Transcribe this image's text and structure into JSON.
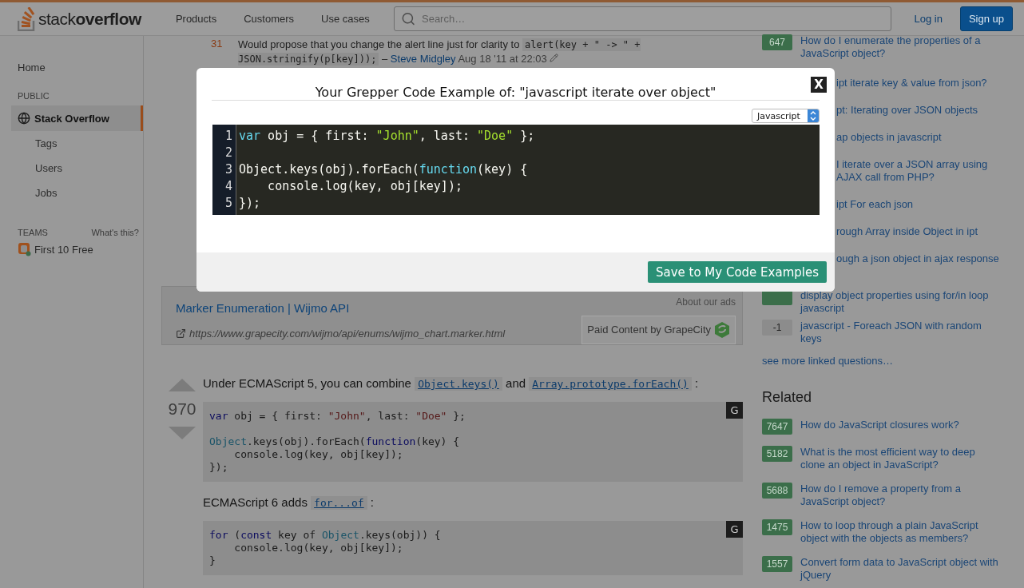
{
  "header": {
    "logo": "stack**overflow**",
    "nav": [
      "Products",
      "Customers",
      "Use cases"
    ],
    "search": {
      "placeholder": "Search…"
    },
    "login": "Log in",
    "signup": "Sign up"
  },
  "sidebar": {
    "home": "Home",
    "public_title": "PUBLIC",
    "items": [
      {
        "label": "Stack Overflow",
        "kind": "site",
        "selected": true
      },
      {
        "label": "Tags",
        "kind": "sub",
        "selected": false
      },
      {
        "label": "Users",
        "kind": "sub",
        "selected": false
      },
      {
        "label": "Jobs",
        "kind": "sub",
        "selected": false
      }
    ],
    "teams_title": "TEAMS",
    "teams_help": "What's this?",
    "teams_item": "First 10 Free"
  },
  "comment": {
    "score": "31",
    "segments": [
      {
        "kind": "text",
        "text": "Would propose that you change the alert line just for clarity to "
      },
      {
        "kind": "code",
        "text": "alert(key + \" -> \" + JSON.stringify(p[key]));"
      },
      {
        "kind": "text",
        "text": " – "
      },
      {
        "kind": "user",
        "text": "Steve Midgley"
      },
      {
        "kind": "date",
        "text": " Aug 18 '11 at 22:03"
      }
    ]
  },
  "ad": {
    "title": "Marker Enumeration | Wijmo API",
    "url": "https://www.grapecity.com/wijmo/api/enums/wijmo_chart.marker.html",
    "about": "About our ads",
    "sponsor": "Paid Content by GrapeCity"
  },
  "answer": {
    "votes": "970",
    "blocks": [
      {
        "kind": "paragraph",
        "segments": [
          {
            "kind": "text",
            "text": "Under ECMAScript 5, you can combine "
          },
          {
            "kind": "code",
            "text": "Object.keys()"
          },
          {
            "kind": "text",
            "text": " and "
          },
          {
            "kind": "code",
            "text": "Array.prototype.forEach()"
          },
          {
            "kind": "text",
            "text": " :"
          }
        ]
      },
      {
        "kind": "code",
        "button": "G",
        "lines": [
          {
            "tokens": [
              {
                "kind": "keyword",
                "text": "var"
              },
              {
                "kind": "plain",
                "text": " obj = { first: "
              },
              {
                "kind": "string",
                "text": "\"John\""
              },
              {
                "kind": "plain",
                "text": ", last: "
              },
              {
                "kind": "string",
                "text": "\"Doe\""
              },
              {
                "kind": "plain",
                "text": " };"
              }
            ]
          },
          {
            "kind": "blank"
          },
          {
            "tokens": [
              {
                "kind": "type",
                "text": "Object"
              },
              {
                "kind": "plain",
                "text": ".keys(obj).forEach("
              },
              {
                "kind": "keyword",
                "text": "function"
              },
              {
                "kind": "plain",
                "text": "(key) {"
              }
            ]
          },
          {
            "tokens": [
              {
                "kind": "plain",
                "text": "    console.log(key, obj[key]);"
              }
            ]
          },
          {
            "tokens": [
              {
                "kind": "plain",
                "text": "});"
              }
            ]
          }
        ]
      },
      {
        "kind": "paragraph",
        "segments": [
          {
            "kind": "text",
            "text": "ECMAScript 6 adds "
          },
          {
            "kind": "code",
            "text": "for...of"
          },
          {
            "kind": "text",
            "text": " :"
          }
        ]
      },
      {
        "kind": "code",
        "button": "G",
        "lines": [
          {
            "tokens": [
              {
                "kind": "keyword",
                "text": "for"
              },
              {
                "kind": "plain",
                "text": " ("
              },
              {
                "kind": "keyword",
                "text": "const"
              },
              {
                "kind": "plain",
                "text": " key of "
              },
              {
                "kind": "type",
                "text": "Object"
              },
              {
                "kind": "plain",
                "text": ".keys(obj)) {"
              }
            ]
          },
          {
            "tokens": [
              {
                "kind": "plain",
                "text": "    console.log(key, obj[key]);"
              }
            ]
          },
          {
            "tokens": [
              {
                "kind": "plain",
                "text": "}"
              }
            ]
          }
        ]
      }
    ]
  },
  "linked": {
    "items": [
      {
        "kind": "full",
        "score": "647",
        "title": "How do I enumerate the properties of a JavaScript object?"
      },
      {
        "kind": "partial",
        "title": "ipt iterate key & value from json?"
      },
      {
        "kind": "partial",
        "title": "pt: Iterating over JSON objects"
      },
      {
        "kind": "partial",
        "title": "ap objects in javascript"
      },
      {
        "kind": "partial",
        "title": "I iterate over a JSON array using AJAX call from PHP?"
      },
      {
        "kind": "partial",
        "title": "ipt For each json"
      },
      {
        "kind": "partial",
        "title": "rough Array inside Object in ipt"
      },
      {
        "kind": "partial",
        "title": "ough a json object in ajax response"
      },
      {
        "kind": "covered",
        "title": "display object properties using for/in loop javascript"
      },
      {
        "kind": "neutral",
        "score": "-1",
        "title": "javascript - Foreach JSON with random keys"
      }
    ],
    "more": "see more linked questions…"
  },
  "related": {
    "title": "Related",
    "items": [
      {
        "score": "7647",
        "title": "How do JavaScript closures work?"
      },
      {
        "score": "5182",
        "title": "What is the most efficient way to deep clone an object in JavaScript?"
      },
      {
        "score": "5688",
        "title": "How do I remove a property from a JavaScript object?"
      },
      {
        "score": "1475",
        "title": "How to loop through a plain JavaScript object with the objects as members?"
      },
      {
        "score": "1557",
        "title": "Convert form data to JavaScript object with jQuery"
      }
    ]
  },
  "modal": {
    "title": "Your Grepper Code Example of: \"javascript iterate over object\"",
    "close": "X",
    "language": "Javascript",
    "lines": [
      {
        "number": "1",
        "tokens": [
          {
            "kind": "keyword",
            "text": "var"
          },
          {
            "kind": "plain",
            "text": " obj = { first: "
          },
          {
            "kind": "string",
            "text": "\"John\""
          },
          {
            "kind": "plain",
            "text": ", last: "
          },
          {
            "kind": "string",
            "text": "\"Doe\""
          },
          {
            "kind": "plain",
            "text": " };"
          }
        ]
      },
      {
        "number": "2"
      },
      {
        "number": "3",
        "tokens": [
          {
            "kind": "plain",
            "text": "Object.keys(obj).forEach("
          },
          {
            "kind": "keyword",
            "text": "function"
          },
          {
            "kind": "plain",
            "text": "(key) {"
          }
        ]
      },
      {
        "number": "4",
        "tokens": [
          {
            "kind": "plain",
            "text": "    console.log(key, obj[key]);"
          }
        ]
      },
      {
        "number": "5",
        "tokens": [
          {
            "kind": "plain",
            "text": "});"
          }
        ]
      }
    ],
    "save": "Save to My Code Examples"
  }
}
